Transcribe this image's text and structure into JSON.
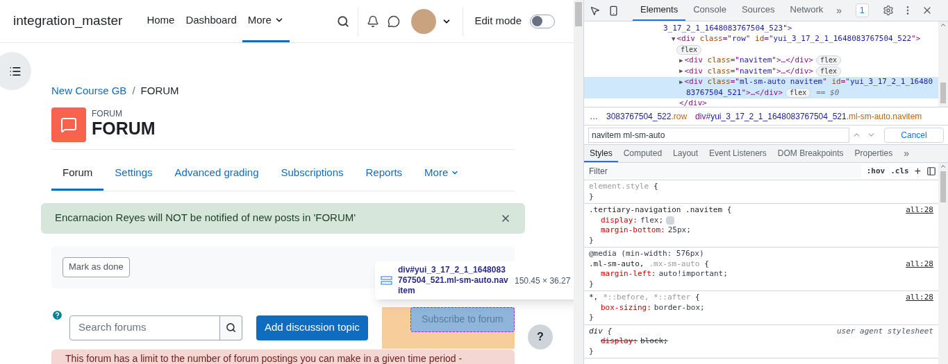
{
  "site_name": "integration_master",
  "nav": [
    {
      "label": "Home",
      "selected": false,
      "dropdown": false
    },
    {
      "label": "Dashboard",
      "selected": false,
      "dropdown": false
    },
    {
      "label": "More",
      "selected": true,
      "dropdown": true
    }
  ],
  "edit_mode": {
    "label": "Edit mode",
    "on": false
  },
  "breadcrumb": [
    {
      "label": "New Course GB",
      "link": true
    },
    {
      "label": "FORUM",
      "link": false
    }
  ],
  "breadcrumb_separator": "/",
  "activity": {
    "type": "FORUM",
    "title": "FORUM"
  },
  "tabs": [
    {
      "label": "Forum",
      "selected": true,
      "dropdown": false
    },
    {
      "label": "Settings",
      "selected": false,
      "dropdown": false
    },
    {
      "label": "Advanced grading",
      "selected": false,
      "dropdown": false
    },
    {
      "label": "Subscriptions",
      "selected": false,
      "dropdown": false
    },
    {
      "label": "Reports",
      "selected": false,
      "dropdown": false
    },
    {
      "label": "More",
      "selected": false,
      "dropdown": true
    }
  ],
  "alert": "Encarnacion Reyes will NOT be notified of new posts in 'FORUM'",
  "mark_done": "Mark as done",
  "search": {
    "placeholder": "Search forums"
  },
  "add_button": "Add discussion topic",
  "subscribe_button": "Subscribe to forum",
  "inspect_tooltip": {
    "selector": "div#yui_3_17_2_1_1648083767504_521.ml-sm-auto.navitem",
    "size": "150.45 × 36.27"
  },
  "warning": "This forum has a limit to the number of forum postings you can make in a given time period -",
  "help": "?",
  "devtools": {
    "tabs": [
      {
        "label": "Elements",
        "selected": true
      },
      {
        "label": "Console",
        "selected": false
      },
      {
        "label": "Sources",
        "selected": false
      },
      {
        "label": "Network",
        "selected": false
      }
    ],
    "more_tabs": "»",
    "issues": "1",
    "dom_lines": [
      {
        "selected": false,
        "tokens": [
          {
            "kind": "value",
            "text": "3_17_2_1_1648083767504_523\""
          },
          {
            "kind": "tag",
            "text": ">"
          }
        ]
      },
      {
        "arrow": "▼",
        "selected": false,
        "tokens": [
          {
            "kind": "tag",
            "text": "<div "
          },
          {
            "kind": "attr",
            "text": "class"
          },
          {
            "kind": "tag",
            "text": "=\""
          },
          {
            "kind": "value",
            "text": "row"
          },
          {
            "kind": "tag",
            "text": "\" "
          },
          {
            "kind": "attr",
            "text": "id"
          },
          {
            "kind": "tag",
            "text": "=\""
          },
          {
            "kind": "value",
            "text": "yui_3_17_2_1_1648083767504_522"
          },
          {
            "kind": "tag",
            "text": "\">"
          }
        ]
      },
      {
        "selected": false,
        "badge": "flex"
      },
      {
        "arrow": "▶",
        "selected": false,
        "tokens": [
          {
            "kind": "tag",
            "text": "<div "
          },
          {
            "kind": "attr",
            "text": "class"
          },
          {
            "kind": "tag",
            "text": "=\""
          },
          {
            "kind": "value",
            "text": "navitem"
          },
          {
            "kind": "tag",
            "text": "\">…</div>"
          }
        ],
        "badge": "flex"
      },
      {
        "arrow": "▶",
        "selected": false,
        "tokens": [
          {
            "kind": "tag",
            "text": "<div "
          },
          {
            "kind": "attr",
            "text": "class"
          },
          {
            "kind": "tag",
            "text": "=\""
          },
          {
            "kind": "value",
            "text": "navitem"
          },
          {
            "kind": "tag",
            "text": "\">…</div>"
          }
        ],
        "badge": "flex"
      },
      {
        "arrow": "▶",
        "selected": true,
        "tokens": [
          {
            "kind": "tag",
            "text": "<div "
          },
          {
            "kind": "attr",
            "text": "class"
          },
          {
            "kind": "tag",
            "text": "=\""
          },
          {
            "kind": "value",
            "text": "ml-sm-auto navitem"
          },
          {
            "kind": "tag",
            "text": "\" "
          },
          {
            "kind": "attr",
            "text": "id"
          },
          {
            "kind": "tag",
            "text": "=\""
          },
          {
            "kind": "value",
            "text": "yui_3_17_2_1_16480"
          }
        ]
      },
      {
        "selected": true,
        "tokens": [
          {
            "kind": "value",
            "text": "83767504_521"
          },
          {
            "kind": "tag",
            "text": "\">…</div>"
          }
        ],
        "badge": "flex",
        "note": "== $0"
      },
      {
        "selected": false,
        "tokens": [
          {
            "kind": "tag",
            "text": "</div>"
          }
        ]
      }
    ],
    "crumbs_more": "…",
    "crumbs": [
      {
        "id": "3083767504_522",
        "cls": ".row"
      },
      {
        "tag": "div",
        "id": "#yui_3_17_2_1_1648083767504_521",
        "cls": ".ml-sm-auto.navitem"
      }
    ],
    "search_value": "navitem ml-sm-auto",
    "cancel": "Cancel",
    "subtabs": [
      {
        "label": "Styles",
        "selected": true
      },
      {
        "label": "Computed",
        "selected": false
      },
      {
        "label": "Layout",
        "selected": false
      },
      {
        "label": "Event Listeners",
        "selected": false
      },
      {
        "label": "DOM Breakpoints",
        "selected": false
      },
      {
        "label": "Properties",
        "selected": false
      }
    ],
    "subtabs_more": "»",
    "filter": {
      "placeholder": "Filter"
    },
    "hov": ":hov",
    "cls": ".cls",
    "plus": "+",
    "rules": [
      {
        "selector": [
          {
            "text": "element.style",
            "dim": true
          },
          {
            "text": "{",
            "dim": false
          }
        ],
        "close": "}"
      },
      {
        "selector": [
          {
            "text": ".tertiary-navigation .navitem {",
            "dim": false
          }
        ],
        "source": "all:28",
        "decls": [
          {
            "prop": "display:",
            "value": "flex;",
            "struck": false,
            "grid_icon": true
          },
          {
            "prop": "margin-bottom:",
            "value": "25px;",
            "struck": false
          }
        ],
        "close": "}"
      },
      {
        "media": "@media (min-width: 576px)",
        "selector": [
          {
            "text": ".ml-sm-auto,",
            "dim": false
          },
          {
            "text": ".mx-sm-auto",
            "dim": true
          },
          {
            "text": "{",
            "dim": false
          }
        ],
        "source": "all:28",
        "decls": [
          {
            "prop": "margin-left:",
            "value": "auto!important;",
            "struck": false
          }
        ],
        "close": "}"
      },
      {
        "selector": [
          {
            "text": "*,",
            "dim": false
          },
          {
            "text": "*::before, *::after",
            "dim": true
          },
          {
            "text": "{",
            "dim": false
          }
        ],
        "source": "all:28",
        "decls": [
          {
            "prop": "box-sizing:",
            "value": "border-box;",
            "struck": false
          }
        ],
        "close": "}"
      },
      {
        "selector": [
          {
            "text": "div {",
            "dim": false
          }
        ],
        "source": "user agent stylesheet",
        "italic": true,
        "decls": [
          {
            "prop": "display:",
            "value": "block;",
            "struck": true
          }
        ],
        "close": "}"
      }
    ]
  }
}
